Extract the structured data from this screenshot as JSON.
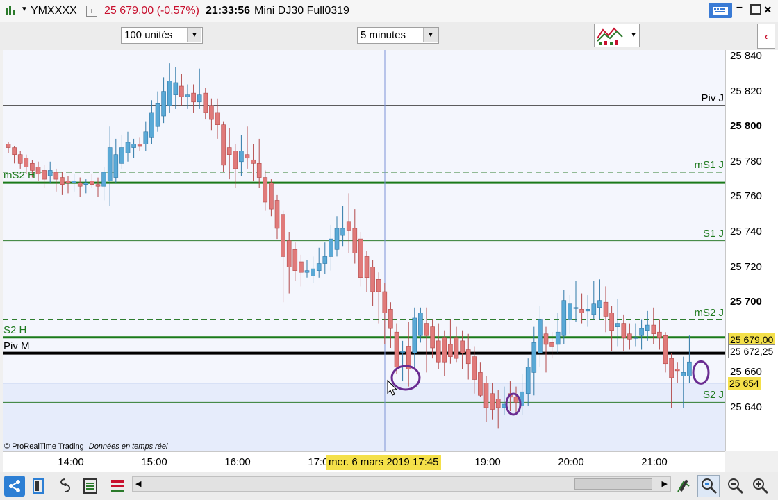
{
  "titlebar": {
    "symbol": "YMXXXX",
    "price_change": "25 679,00 (-0,57%)",
    "time": "21:33:56",
    "instrument": "Mini DJ30 Full0319",
    "change_color": "#c8102e"
  },
  "toolbar": {
    "units": "100 unités",
    "period": "5 minutes"
  },
  "chart": {
    "copyright": "© ProRealTime Trading",
    "realtime": "Données en temps réel",
    "crosshair_label": "mer. 6 mars 2019 17:45",
    "levels": [
      {
        "label": "Piv J",
        "price": 25812,
        "color": "#000000",
        "dash": false,
        "width": 1,
        "side": "right"
      },
      {
        "label": "mS1 J",
        "price": 25774,
        "color": "#2f7d2f",
        "dash": true,
        "width": 1,
        "side": "right"
      },
      {
        "label": "mS2 H",
        "price": 25768,
        "color": "#1a7a1a",
        "dash": false,
        "width": 3,
        "side": "left"
      },
      {
        "label": "S1 J",
        "price": 25735,
        "color": "#2f7d2f",
        "dash": false,
        "width": 1,
        "side": "right"
      },
      {
        "label": "mS2 J",
        "price": 25690,
        "color": "#2f7d2f",
        "dash": true,
        "width": 1,
        "side": "right"
      },
      {
        "label": "S2 H",
        "price": 25680,
        "color": "#1a7a1a",
        "dash": false,
        "width": 3,
        "side": "left"
      },
      {
        "label": "Piv M",
        "price": 25671,
        "color": "#000000",
        "dash": false,
        "width": 4,
        "side": "left"
      },
      {
        "label": "S2 J",
        "price": 25643,
        "color": "#2f7d2f",
        "dash": false,
        "width": 1,
        "side": "right"
      }
    ],
    "bull_color": "#5aa9d6",
    "bear_color": "#e07a7a",
    "highlight_color": "#6a2c91"
  },
  "price_axis": {
    "ticks": [
      "25 840",
      "25 820",
      "25 800",
      "25 780",
      "25 760",
      "25 740",
      "25 720",
      "25 700",
      "25 680",
      "25 660",
      "25 640"
    ],
    "tick_values": [
      25840,
      25820,
      25800,
      25780,
      25760,
      25740,
      25720,
      25700,
      25680,
      25660,
      25640
    ],
    "bold_ticks": [
      "25 800",
      "25 700"
    ],
    "last_price": "25 679,00",
    "mid_price": "25 672,25",
    "cursor_price": "25 654",
    "last_price_value": 25679,
    "mid_price_value": 25672.25,
    "cursor_price_value": 25654
  },
  "time_axis": {
    "ticks": [
      "14:00",
      "15:00",
      "16:00",
      "17:00",
      "19:00",
      "20:00",
      "21:00"
    ]
  },
  "icons": [
    "chart-app-icon",
    "keyboard-icon",
    "minimize-icon",
    "maximize-icon",
    "close-icon",
    "share-icon",
    "layout-icon",
    "indicator-icon",
    "list-icon",
    "compare-icon",
    "scroll-left-icon",
    "scroll-right-icon",
    "draw-tool-icon",
    "zoom-fit-icon",
    "zoom-out-icon",
    "zoom-in-icon",
    "indicators-panel-icon",
    "collapse-icon"
  ]
}
